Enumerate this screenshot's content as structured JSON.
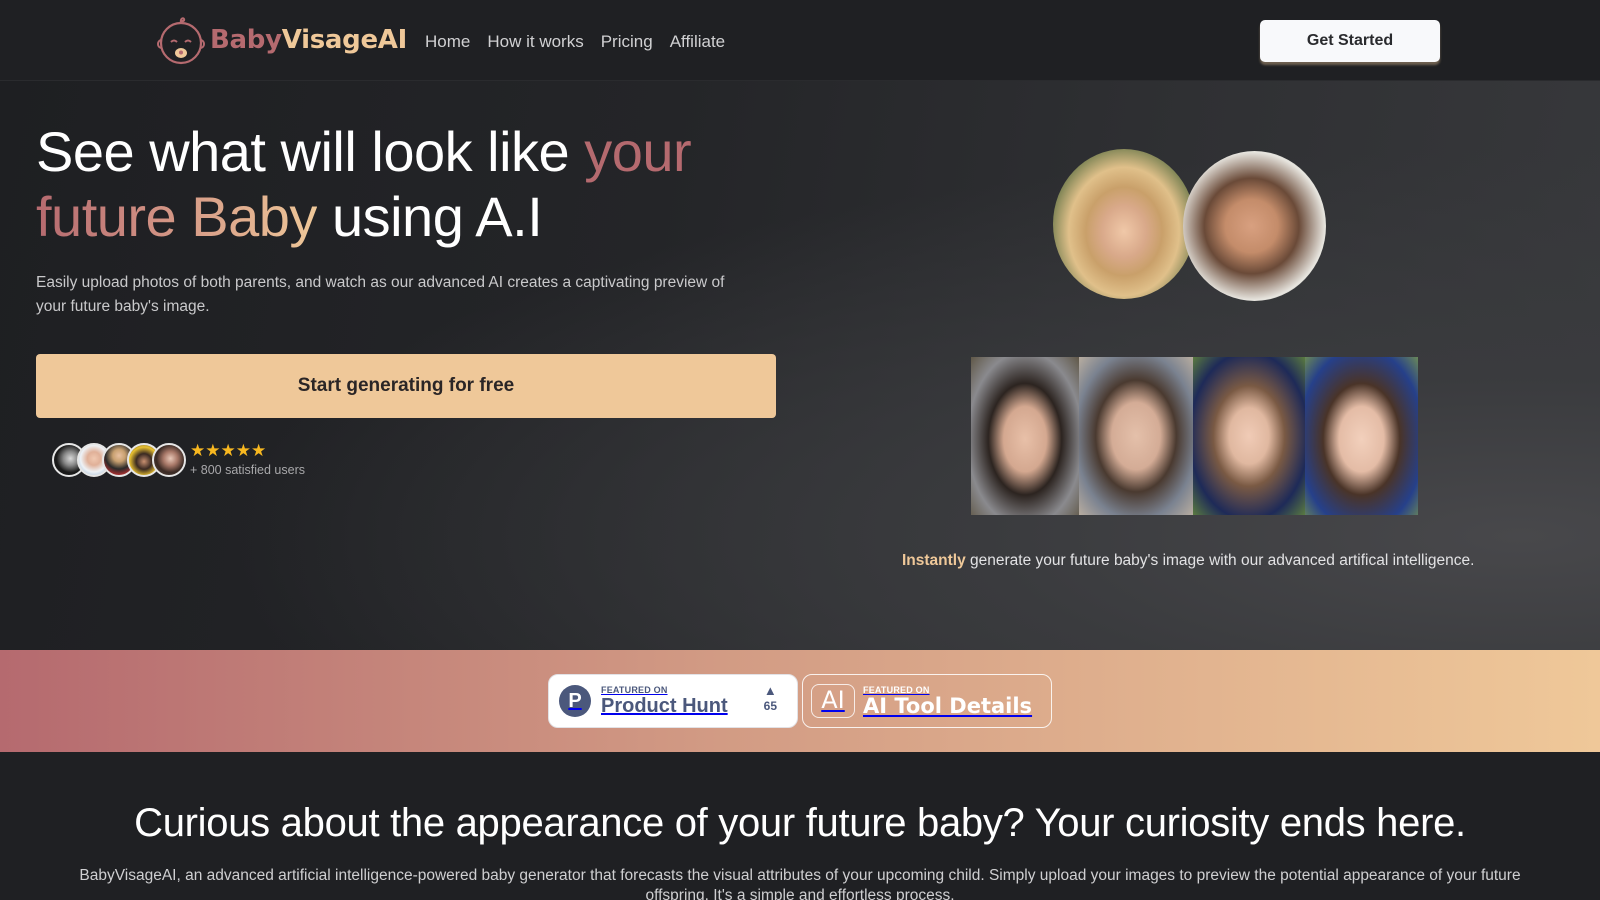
{
  "brand": {
    "name_part1": "Baby",
    "name_part2": "VisageAI",
    "logo_icon": "baby-face-icon",
    "colors": {
      "rose": "#b56a6f",
      "peach": "#efc899",
      "dark": "#1f2023",
      "star": "#f8b820",
      "product_hunt": "#4b587c"
    }
  },
  "nav": {
    "items": [
      {
        "label": "Home"
      },
      {
        "label": "How it works"
      },
      {
        "label": "Pricing"
      },
      {
        "label": "Affiliate"
      }
    ],
    "cta_label": "Get Started"
  },
  "hero": {
    "title_part1": "See what will look like ",
    "title_highlight1": "your",
    "title_highlight2": "future Baby",
    "title_part2": " using A.I",
    "subtitle": "Easily upload photos of both parents, and watch as our advanced AI creates a captivating preview of your future baby's image.",
    "cta_label": "Start generating for free",
    "rating_stars": "★★★★★",
    "rating_value": 5,
    "social_proof": "+ 800 satisfied users",
    "avatar_count": 5,
    "caption_bold": "Instantly",
    "caption_rest": " generate your future baby's image with our advanced artifical intelligence.",
    "parents": [
      "mother-photo",
      "father-photo"
    ],
    "babies": [
      "baby-photo-1",
      "baby-photo-2",
      "baby-photo-3",
      "baby-photo-4"
    ]
  },
  "featured": {
    "product_hunt": {
      "small": "FEATURED ON",
      "big": "Product Hunt",
      "logo_letter": "P",
      "upvote_icon": "▲",
      "votes": "65"
    },
    "ai_tool_details": {
      "small": "FEATURED ON",
      "big": "AI Tool Details",
      "logo_text": "AI"
    }
  },
  "section2": {
    "title": "Curious about the appearance of your future baby? Your curiosity ends here.",
    "text": "BabyVisageAI, an advanced artificial intelligence-powered baby generator that forecasts the visual attributes of your upcoming child. Simply upload your images to preview the potential appearance of your future offspring. It's a simple and effortless process."
  }
}
